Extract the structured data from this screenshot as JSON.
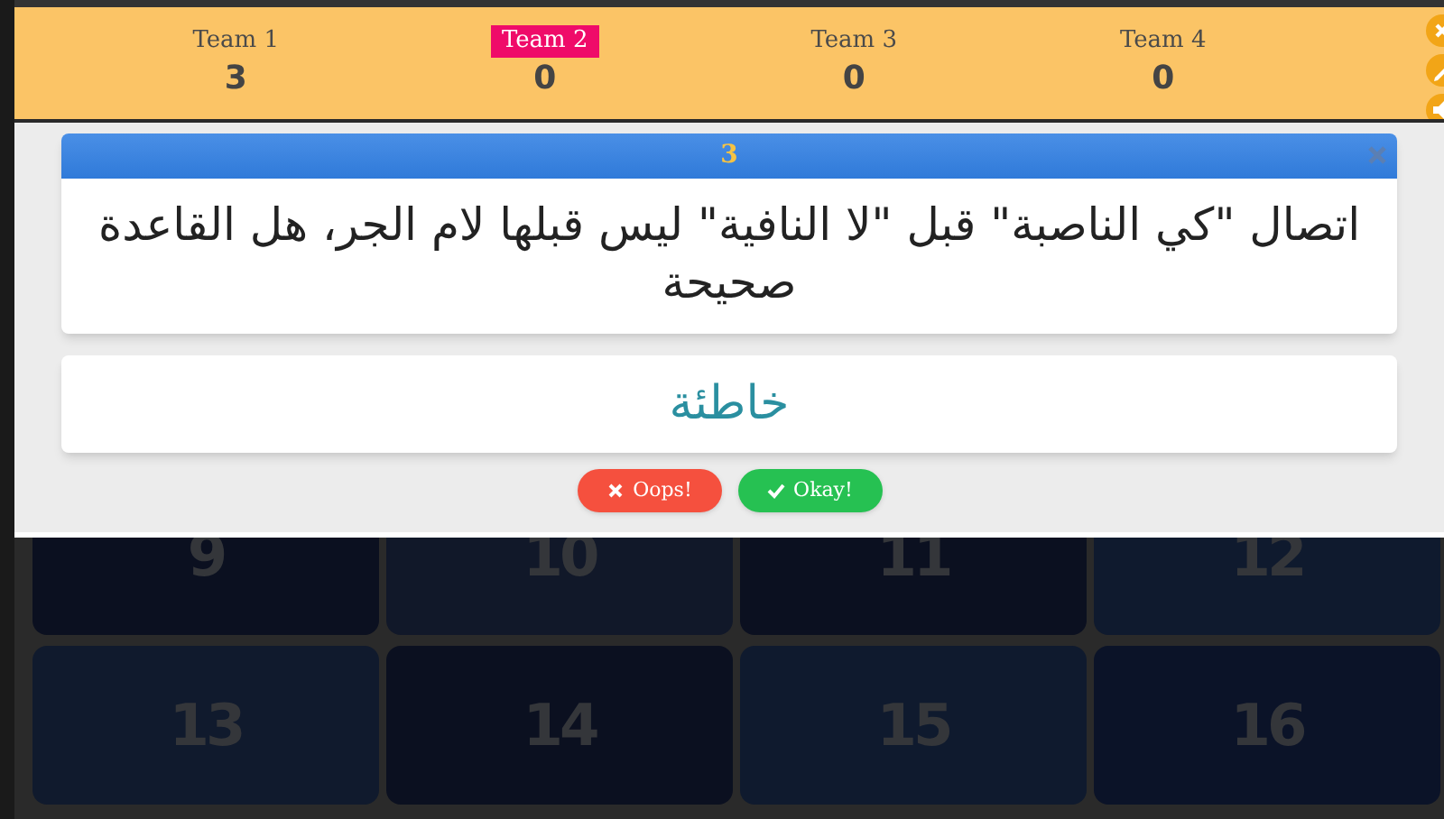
{
  "teams": [
    {
      "name": "Team 4",
      "score": "0",
      "selected": false
    },
    {
      "name": "Team 3",
      "score": "0",
      "selected": false
    },
    {
      "name": "Team 2",
      "score": "0",
      "selected": true
    },
    {
      "name": "Team 1",
      "score": "3",
      "selected": false
    }
  ],
  "side_tools": [
    {
      "kind": "close"
    },
    {
      "kind": "edit"
    },
    {
      "kind": "sound"
    }
  ],
  "modal": {
    "number": "3",
    "question": "اتصال \"كي الناصبة\" قبل \"لا النافية\" ليس قبلها لام الجر، هل القاعدة صحيحة",
    "answer": "خاطئة",
    "buttons": [
      {
        "kind": "okay",
        "label": "Okay!"
      },
      {
        "kind": "oops",
        "label": "Oops!"
      }
    ]
  },
  "tiles": [
    "12",
    "11",
    "10",
    "9",
    "16",
    "15",
    "14",
    "13"
  ]
}
